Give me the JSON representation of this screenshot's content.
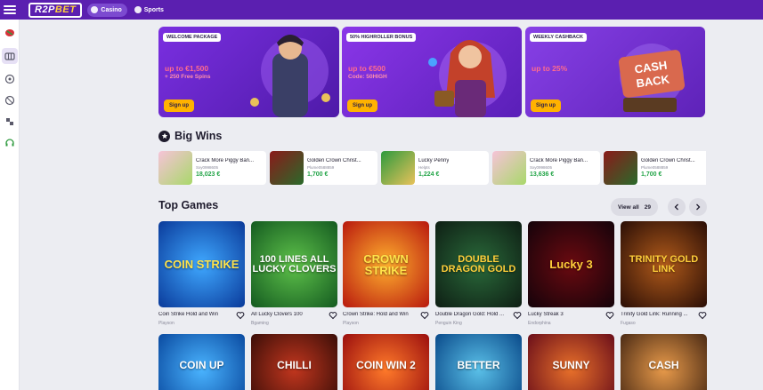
{
  "header": {
    "logo": {
      "part1": "R2P",
      "part2": "BET"
    },
    "tabs": [
      {
        "label": "Casino"
      },
      {
        "label": "Sports"
      }
    ]
  },
  "promos": [
    {
      "tag": "WELCOME PACKAGE",
      "amount": "up to €1,500",
      "sub": "+ 250 Free Spins",
      "button": "Sign up"
    },
    {
      "tag": "50% HIGHROLLER BONUS",
      "amount": "up to €500",
      "sub": "Code: 50HIGH",
      "button": "Sign up"
    },
    {
      "tag": "WEEKLY CASHBACK",
      "amount": "up to 25%",
      "sub": "",
      "button": "Sign up"
    }
  ],
  "bigwins": {
    "title": "Big Wins",
    "items": [
      {
        "game": "Crack More Piggy Ban...",
        "user": "Sxy0998605",
        "amount": "18,023 €"
      },
      {
        "game": "Golden Crown Christ...",
        "user": "Plume0588859",
        "amount": "1,700 €"
      },
      {
        "game": "Lucky Penny",
        "user": "Helpts",
        "amount": "1,224 €"
      },
      {
        "game": "Crack More Piggy Ban...",
        "user": "Sxy0998605",
        "amount": "13,636 €"
      },
      {
        "game": "Golden Crown Christ...",
        "user": "Plume0588859",
        "amount": "1,700 €"
      }
    ]
  },
  "topgames": {
    "title": "Top Games",
    "view_all": "View all",
    "count": "29",
    "items": [
      {
        "name": "Coin Strike Hold and Win",
        "provider": "Playson",
        "art": "COIN STRIKE"
      },
      {
        "name": "All Lucky Clovers 100",
        "provider": "Bgaming",
        "art": "100 LINES ALL LUCKY CLOVERS"
      },
      {
        "name": "Crown Strike: Hold and Win",
        "provider": "Playson",
        "art": "CROWN STRIKE"
      },
      {
        "name": "Double Dragon Gold: Hold ...",
        "provider": "Penguin King",
        "art": "DOUBLE DRAGON GOLD"
      },
      {
        "name": "Lucky Streak 3",
        "provider": "Endorphina",
        "art": "Lucky 3"
      },
      {
        "name": "Trinity Gold Link: Running ...",
        "provider": "Fugaso",
        "art": "TRINITY GOLD LINK"
      }
    ],
    "row2": [
      {
        "art": "COIN UP"
      },
      {
        "art": "CHILLI"
      },
      {
        "art": "COIN WIN 2"
      },
      {
        "art": "BETTER"
      },
      {
        "art": "SUNNY"
      },
      {
        "art": "CASH"
      }
    ]
  },
  "colors": {
    "brand": "#5b1fb0",
    "accent": "#ffb200",
    "win": "#22a447"
  }
}
